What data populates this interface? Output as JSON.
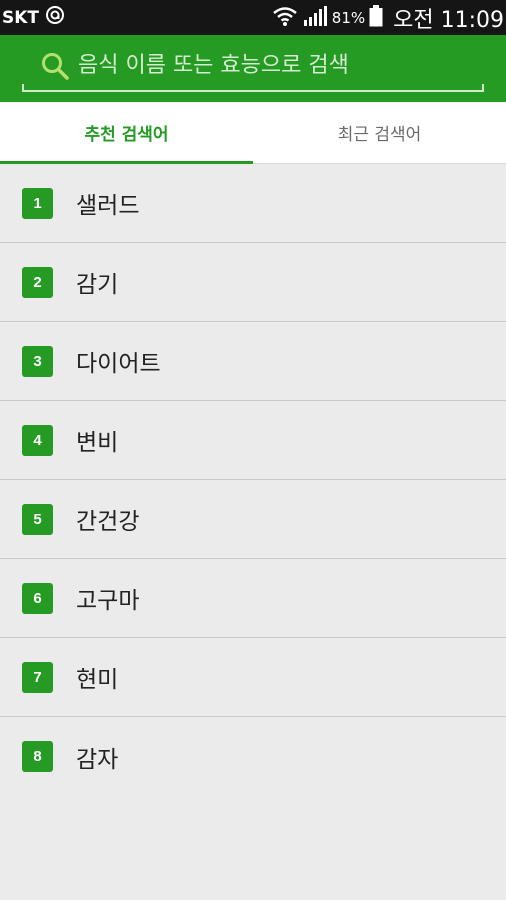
{
  "status_bar": {
    "carrier": "SKT",
    "battery": "81%",
    "time": "오전 11:09"
  },
  "search": {
    "placeholder": "음식 이름 또는 효능으로 검색"
  },
  "tabs": [
    {
      "label": "추천 검색어",
      "active": true
    },
    {
      "label": "최근 검색어",
      "active": false
    }
  ],
  "recommended": [
    {
      "rank": "1",
      "label": "샐러드"
    },
    {
      "rank": "2",
      "label": "감기"
    },
    {
      "rank": "3",
      "label": "다이어트"
    },
    {
      "rank": "4",
      "label": "변비"
    },
    {
      "rank": "5",
      "label": "간건강"
    },
    {
      "rank": "6",
      "label": "고구마"
    },
    {
      "rank": "7",
      "label": "현미"
    },
    {
      "rank": "8",
      "label": "감자"
    }
  ],
  "colors": {
    "brand_green": "#259b24",
    "status_bar": "#151515",
    "list_background": "#ebebeb"
  }
}
